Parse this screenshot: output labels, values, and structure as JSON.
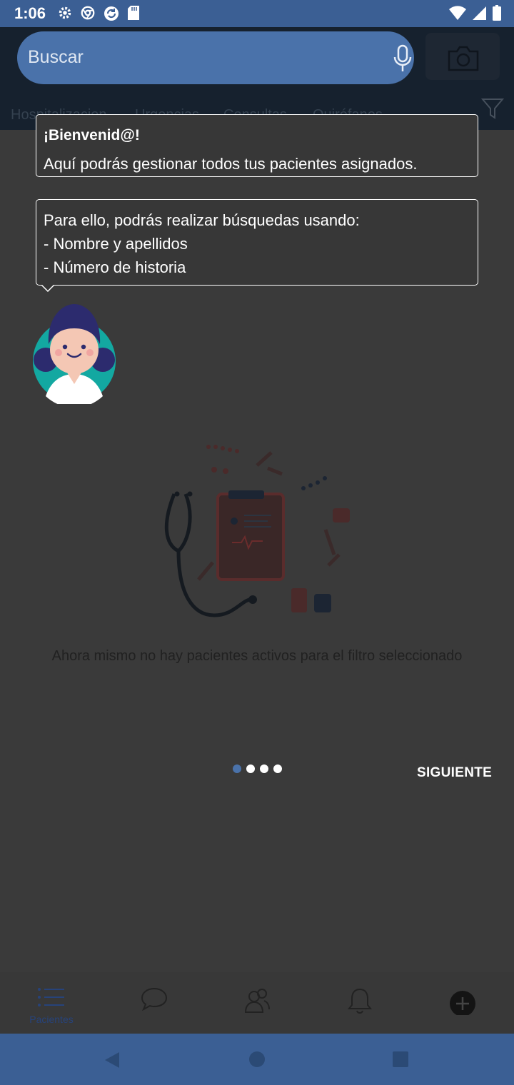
{
  "status_bar": {
    "time": "1:06",
    "left_icons": [
      "settings-icon",
      "chrome-icon",
      "sync-icon",
      "sd-card-icon"
    ],
    "right_icons": [
      "wifi-icon",
      "signal-icon",
      "battery-icon"
    ]
  },
  "header": {
    "search_placeholder": "Buscar",
    "tabs": [
      "Hospitalizacion",
      "Urgencias",
      "Consultas",
      "Quirófanos"
    ]
  },
  "empty_state": {
    "message": "Ahora mismo no hay pacientes activos para el filtro seleccionado"
  },
  "bottom_nav": {
    "items": [
      {
        "label": "Pacientes",
        "icon": "list-icon"
      },
      {
        "label": "",
        "icon": "chat-icon"
      },
      {
        "label": "",
        "icon": "users-icon"
      },
      {
        "label": "",
        "icon": "bell-icon"
      },
      {
        "label": "",
        "icon": "plus-circle-icon"
      }
    ]
  },
  "tutorial": {
    "welcome_title": "¡Bienvenid@!",
    "welcome_text": "Aquí podrás gestionar todos tus pacientes asignados.",
    "search_lines": [
      "Para ello, podrás realizar búsquedas usando:",
      "- Nombre y apellidos",
      "- Número de historia"
    ],
    "pager": {
      "total": 4,
      "active": 1
    },
    "next_label": "SIGUIENTE"
  },
  "colors": {
    "accent": "#4a72aa",
    "status_bar": "#3b5f94",
    "overlay_bg": "#3a3a3a"
  }
}
